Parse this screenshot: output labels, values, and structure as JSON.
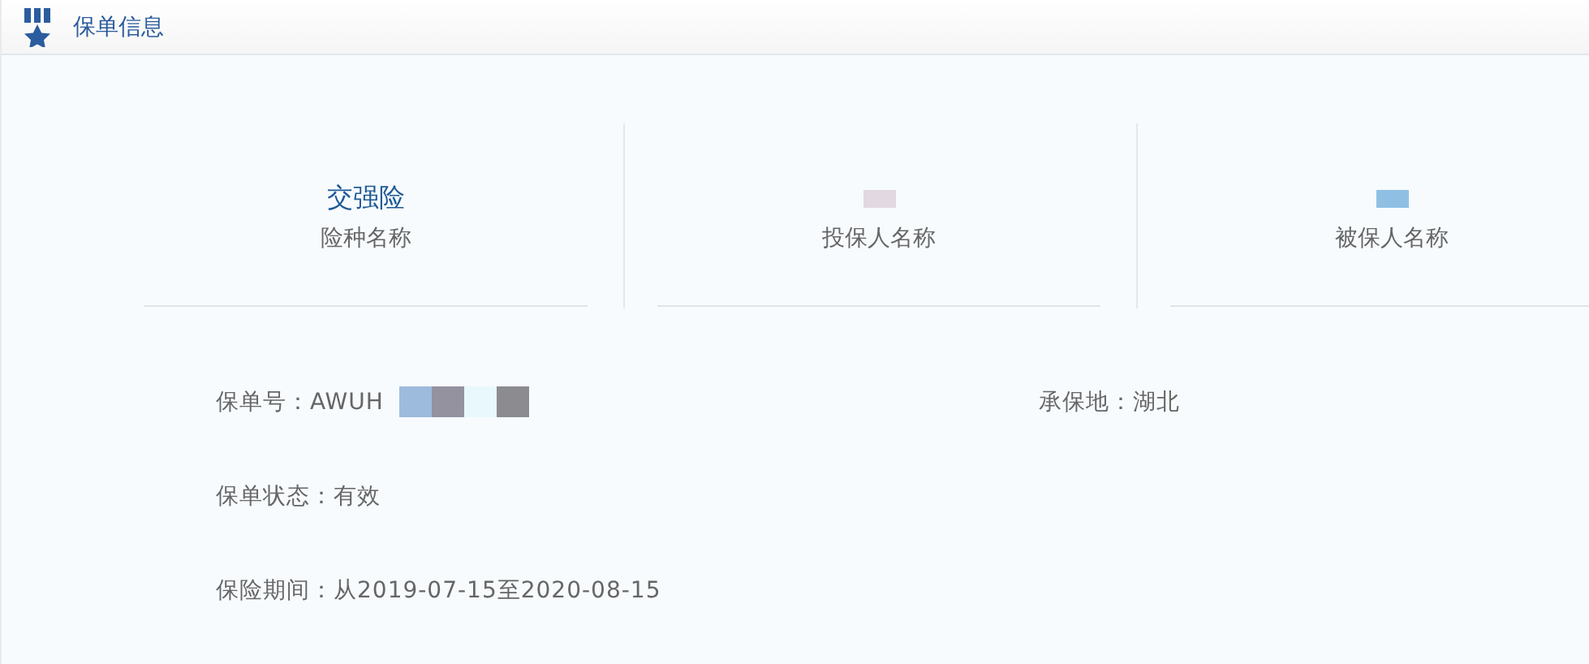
{
  "header": {
    "title": "保单信息"
  },
  "summary": [
    {
      "value": "交强险",
      "label": "险种名称"
    },
    {
      "redactions": [
        {
          "color": "#e2d8e2"
        }
      ],
      "label": "投保人名称"
    },
    {
      "redactions": [
        {
          "color": "#8fc0e4"
        }
      ],
      "label": "被保人名称"
    }
  ],
  "fields": [
    {
      "label": "保单号：",
      "value": "AWUH",
      "redactions": [
        {
          "color": "#9dbbdc"
        },
        {
          "color": "#94929f"
        },
        {
          "color": "#e8f8fc"
        },
        {
          "color": "#8c8c90"
        }
      ],
      "extra": {
        "label": "承保地：",
        "value": "湖北"
      }
    },
    {
      "label": "保单状态：",
      "value": "有效"
    },
    {
      "label": "保险期间：",
      "value": "从2019-07-15至2020-08-15"
    }
  ]
}
